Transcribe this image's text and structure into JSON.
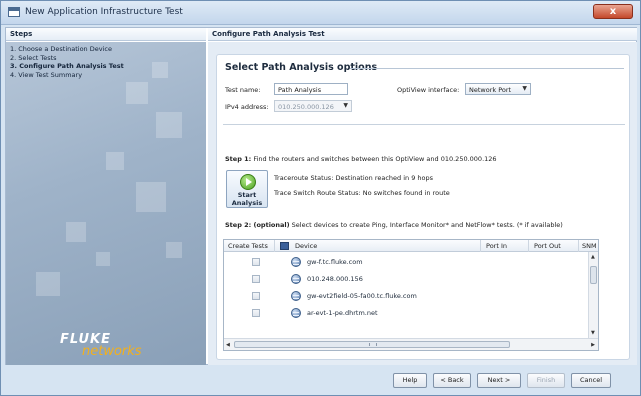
{
  "window": {
    "title": "New Application Infrastructure Test",
    "close_glyph": "x"
  },
  "steps": {
    "header": "Steps",
    "items": [
      {
        "label": "1. Choose a Destination Device",
        "active": false
      },
      {
        "label": "2. Select Tests",
        "active": false
      },
      {
        "label": "3. Configure Path Analysis Test",
        "active": true
      },
      {
        "label": "4. View Test Summary",
        "active": false
      }
    ],
    "logo_top": "FLUKE",
    "logo_bottom": "networks"
  },
  "main": {
    "header": "Configure Path Analysis Test",
    "section_title": "Select Path Analysis options",
    "test_name_label": "Test name:",
    "test_name_value": "Path Analysis",
    "optiview_interface_label": "OptiView interface:",
    "optiview_interface_value": "Network Port",
    "ipv4_label": "IPv4 address:",
    "ipv4_value": "010.250.000.126",
    "step1_bold": "Step 1:",
    "step1_text": " Find the routers and switches between this OptiView and 010.250.000.126",
    "start_button_line1": "Start",
    "start_button_line2": "Analysis",
    "traceroute_status": "Traceroute Status:  Destination reached in 9 hops",
    "trace_switch_status": "Trace Switch Route Status:  No switches found in route",
    "step2_bold": "Step 2: (optional)",
    "step2_text": " Select devices to create Ping, Interface Monitor* and NetFlow* tests. (* if available)"
  },
  "table": {
    "columns": [
      "Create Tests",
      "Device",
      "Port In",
      "Port Out",
      "SNM"
    ],
    "rows": [
      {
        "device": "gw-f.tc.fluke.com",
        "icon": "globe-icon"
      },
      {
        "device": "010.248.000.156",
        "icon": "globe-icon"
      },
      {
        "device": "gw-evt2field-05-fa00.tc.fluke.com",
        "icon": "globe-icon"
      },
      {
        "device": "ar-evt-1-pe.dhrtm.net",
        "icon": "globe-icon"
      }
    ]
  },
  "footer": {
    "help": "Help",
    "back": "< Back",
    "next": "Next >",
    "finish": "Finish",
    "cancel": "Cancel"
  }
}
